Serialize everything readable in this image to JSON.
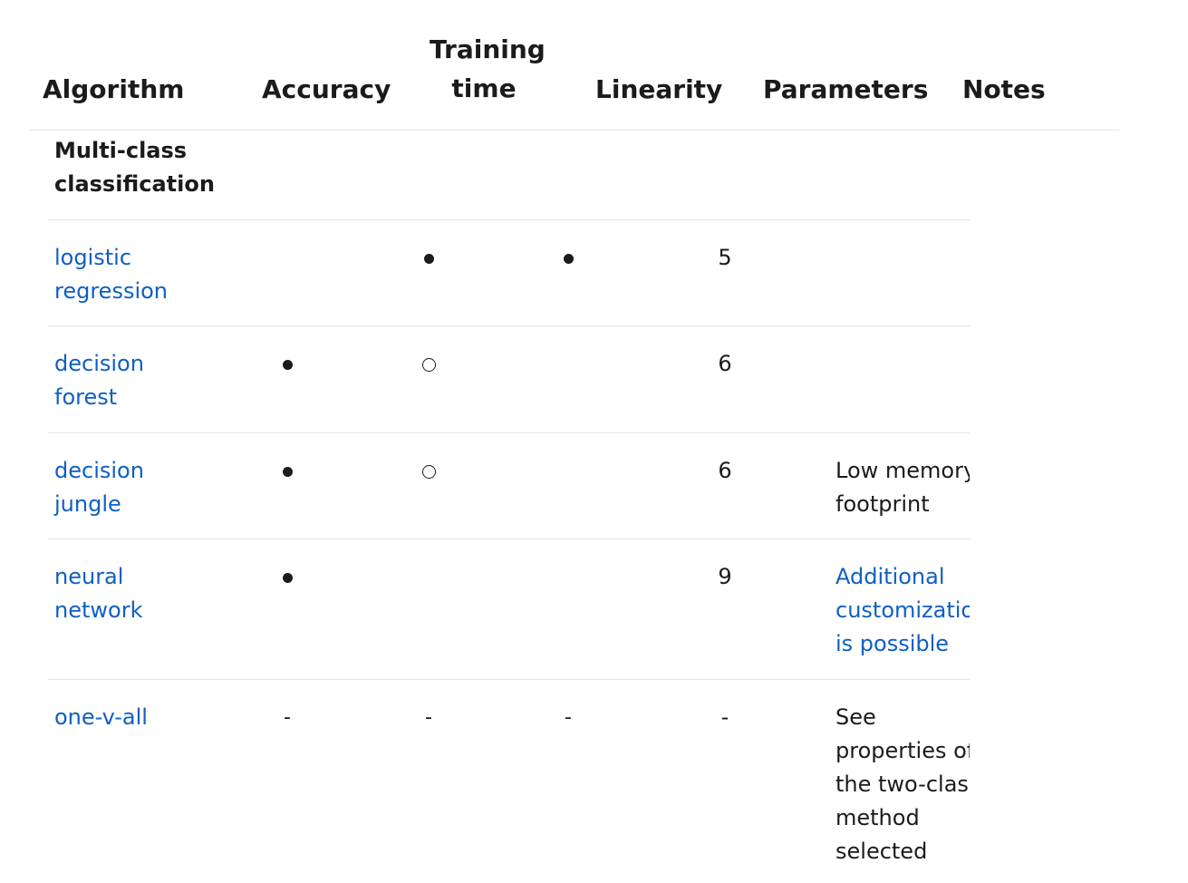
{
  "header": {
    "algorithm": "Algorithm",
    "accuracy": "Accuracy",
    "training_time_line1": "Training",
    "training_time_line2": "time",
    "linearity": "Linearity",
    "parameters": "Parameters",
    "notes": "Notes"
  },
  "section_title_line1": "Multi-class",
  "section_title_line2": "classification",
  "rows": [
    {
      "algorithm_line1": "logistic",
      "algorithm_line2": "regression",
      "accuracy": "",
      "training_time": "●",
      "linearity": "●",
      "parameters": "5",
      "notes": []
    },
    {
      "algorithm_line1": "decision",
      "algorithm_line2": "forest",
      "accuracy": "●",
      "training_time": "○",
      "linearity": "",
      "parameters": "6",
      "notes": []
    },
    {
      "algorithm_line1": "decision",
      "algorithm_line2": "jungle",
      "accuracy": "●",
      "training_time": "○",
      "linearity": "",
      "parameters": "6",
      "notes": [
        "Low memory",
        "footprint"
      ]
    },
    {
      "algorithm_line1": "neural",
      "algorithm_line2": "network",
      "accuracy": "●",
      "training_time": "",
      "linearity": "",
      "parameters": "9",
      "notes": [
        "Additional",
        "customizatior",
        "is possible"
      ]
    },
    {
      "algorithm_line1": "one-v-all",
      "algorithm_line2": "",
      "accuracy": "-",
      "training_time": "-",
      "linearity": "-",
      "parameters": "-",
      "notes": [
        "See",
        "properties of",
        "the two-class",
        "method",
        "selected"
      ]
    }
  ],
  "colors": {
    "link": "#0f5fc3",
    "text": "#1b1b1b",
    "rule": "#e3e3e3"
  }
}
